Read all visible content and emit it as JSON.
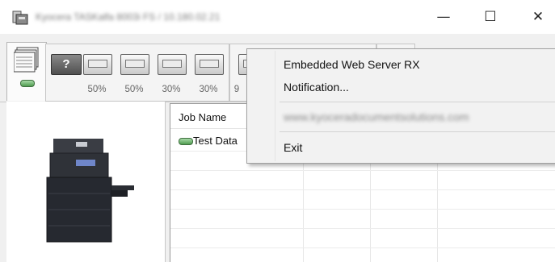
{
  "window": {
    "title": "Kyocera TASKalfa 8003i FS / 10.180.02.21",
    "controls": {
      "minimize": "—",
      "maximize": "☐",
      "close": "✕"
    }
  },
  "toolbar": {
    "tray_percentages": [
      "50%",
      "50%",
      "30%",
      "30%",
      "9"
    ],
    "help_tray_symbol": "?"
  },
  "job_list": {
    "column_header": "Job Name",
    "rows": [
      {
        "name": "Test Data"
      }
    ]
  },
  "context_menu": {
    "items": [
      {
        "label": "Embedded Web Server RX"
      },
      {
        "label": "Notification..."
      },
      {
        "label": "www.kyoceradocumentsolutions.com"
      },
      {
        "label": "Exit"
      }
    ]
  },
  "colors": {
    "menu_background": "#f2f2f2",
    "status_led": "#6fbf6f"
  }
}
